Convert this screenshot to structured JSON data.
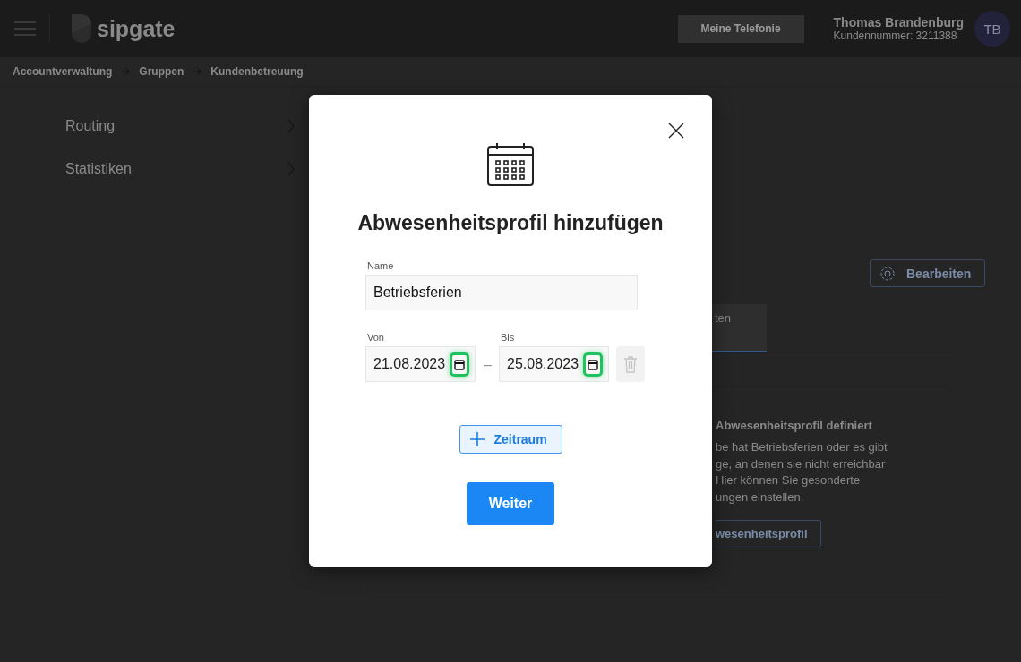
{
  "header": {
    "logo": "sipgate",
    "telephony_button": "Meine Telefonie",
    "user_name": "Thomas Brandenburg",
    "customer_number": "Kundennummer: 3211388",
    "avatar_initials": "TB"
  },
  "breadcrumb": [
    "Accountverwaltung",
    "Gruppen",
    "Kundenbetreuung"
  ],
  "sidebar": {
    "items": [
      {
        "label": "Routing"
      },
      {
        "label": "Statistiken"
      }
    ]
  },
  "content": {
    "edit_button": "Bearbeiten",
    "tabs": [
      {
        "label": "ten",
        "selected": true
      }
    ],
    "card": {
      "heading": "Abwesenheitsprofil definiert",
      "lines": [
        "be hat Betriebsferien oder es gibt",
        "ge, an denen sie nicht erreichbar",
        "Hier können Sie gesonderte",
        "ungen einstellen."
      ],
      "button": "wesenheitsprofil"
    }
  },
  "dialog": {
    "title": "Abwesenheitsprofil hinzufügen",
    "name_field": {
      "label": "Name",
      "value": "Betriebsferien"
    },
    "date_fields": [
      {
        "label": "Von",
        "value": "21.08.2023",
        "highlighted": true
      },
      {
        "label": "Bis",
        "value": "25.08.2023",
        "highlighted": true
      }
    ],
    "separator": "–",
    "add_period_button": "Zeitraum",
    "submit_button": "Weiter"
  }
}
